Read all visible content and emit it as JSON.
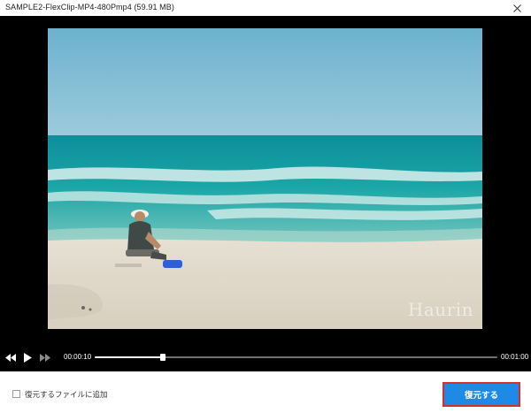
{
  "window": {
    "title": "SAMPLE2-FlexClip-MP4-480Pmp4 (59.91 MB)"
  },
  "video": {
    "watermark": "Haurin"
  },
  "playback": {
    "current_time": "00:00:10",
    "total_time": "00:01:00",
    "progress": 0.17
  },
  "footer": {
    "checkbox_label": "復元するファイルに追加",
    "checkbox_checked": false,
    "restore_button": "復元する"
  },
  "colors": {
    "accent": "#1e8ae6",
    "highlight_border": "#d93025"
  },
  "icons": [
    "close-icon",
    "rewind-icon",
    "play-icon",
    "fast-forward-icon"
  ]
}
